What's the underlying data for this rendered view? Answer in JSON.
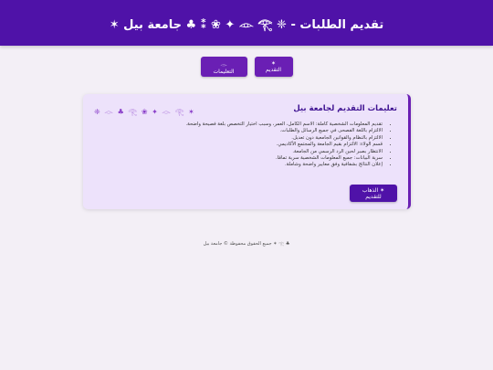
{
  "header": {
    "title": "تقديم الطلبات - ❈ 𓁹 𓂀 ✦ ❀ ⁑ ♣ جامعة بيل ✶"
  },
  "nav": {
    "apply_label": "✶ التقديم",
    "instructions_label": "𓁹 التعليمات"
  },
  "card": {
    "title": "تعليمات التقديم لجامعة بيل",
    "deco": "✶ 𓁹 ♣ 𓂀 ❀ ✦ 𓁹 𓂀 ❈",
    "items": [
      "تقديم المعلومات الشخصية كاملة: الاسم الكامل، العمر، وسبب اختيار التخصص بلغة فصيحة واضحة.",
      "الالتزام باللغة الفصحى في جميع الرسائل والطلبات.",
      "الالتزام بالنظام والقوانين الجامعية دون تعديل.",
      "قسم الولاء: الالتزام بقيم الجامعة والمجتمع الأكاديمي.",
      "الانتظار بصبر لحين الرد الرسمي من الجامعة.",
      "سرية البيانات: جميع المعلومات الشخصية سرية تمامًا.",
      "إعلان النتائج بشفافية وفق معايير واضحة وشاملة."
    ],
    "go_label": "✶ الذهاب للتقديم"
  },
  "footer": {
    "text": "♣ 𓂀 ✶ جميع الحقوق محفوظة © جامعة بيل"
  }
}
